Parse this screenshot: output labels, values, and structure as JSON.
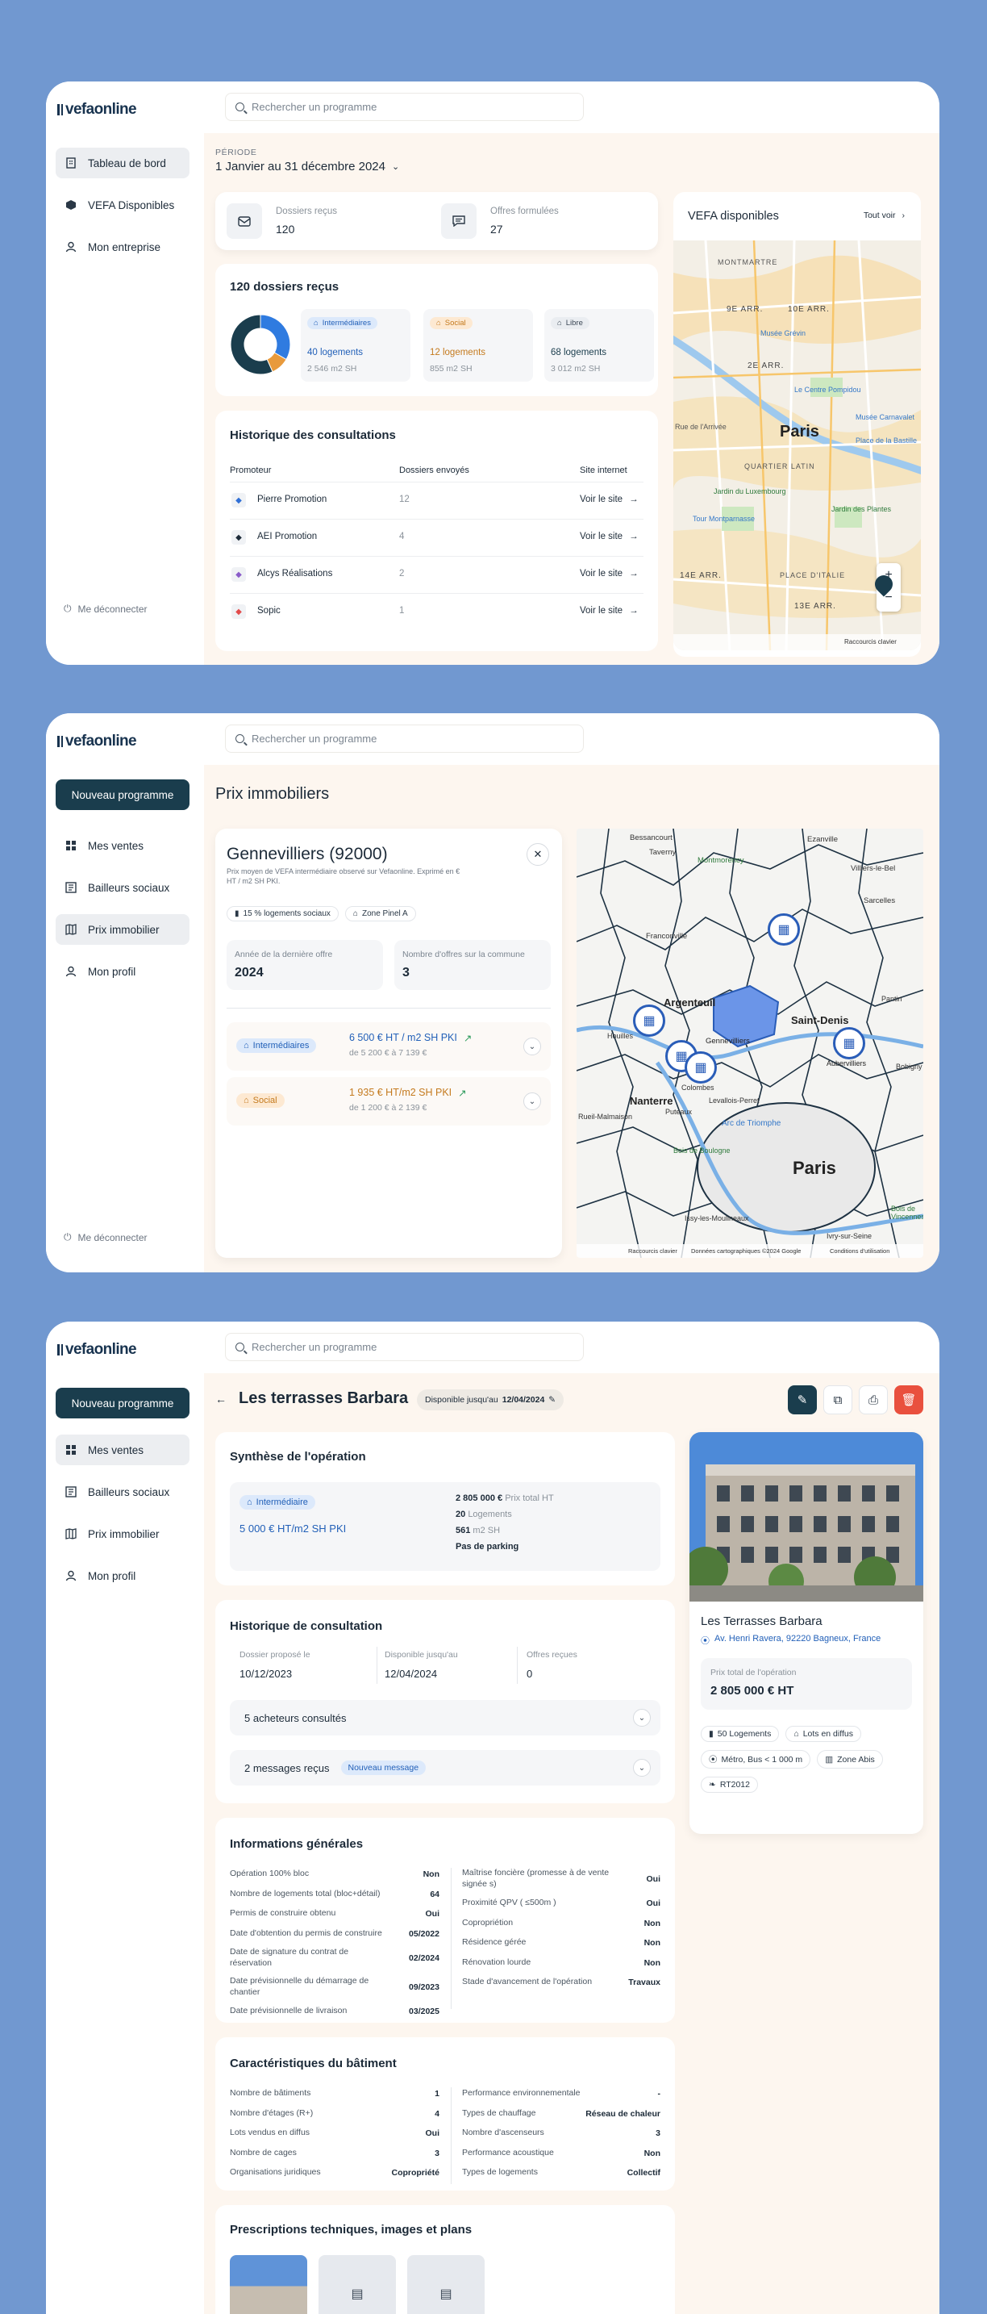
{
  "logo": "vefaonline",
  "search_placeholder": "Rechercher un programme",
  "logout": "Me déconnecter",
  "screen1": {
    "nav": [
      "Tableau de bord",
      "VEFA Disponibles",
      "Mon entreprise"
    ],
    "period_label": "PÉRIODE",
    "period_value": "1 Janvier au 31 décembre 2024",
    "stats": [
      {
        "label": "Dossiers reçus",
        "value": "120"
      },
      {
        "label": "Offres formulées",
        "value": "27"
      }
    ],
    "dossiers_title": "120 dossiers reçus",
    "donut": [
      {
        "name": "Intermédiaires",
        "logements": "40 logements",
        "surface": "2 546 m2 SH",
        "value": 40,
        "color": "#2f7be0"
      },
      {
        "name": "Social",
        "logements": "12 logements",
        "surface": "855 m2 SH",
        "value": 12,
        "color": "#e89a3c"
      },
      {
        "name": "Libre",
        "logements": "68 logements",
        "surface": "3 012 m2 SH",
        "value": 68,
        "color": "#1a3d4d"
      }
    ],
    "history_title": "Historique des consultations",
    "history_headers": [
      "Promoteur",
      "Dossiers envoyés",
      "Site internet"
    ],
    "history_rows": [
      {
        "name": "Pierre Promotion",
        "count": "12",
        "link": "Voir le site"
      },
      {
        "name": "AEI Promotion",
        "count": "4",
        "link": "Voir le site"
      },
      {
        "name": "Alcys Réalisations",
        "count": "2",
        "link": "Voir le site"
      },
      {
        "name": "Sopic",
        "count": "1",
        "link": "Voir le site"
      }
    ],
    "vefa_title": "VEFA disponibles",
    "vefa_link": "Tout voir",
    "map_labels": [
      "MONTMARTRE",
      "9E ARR.",
      "10E ARR.",
      "Musée Grévin",
      "2E ARR.",
      "Le Centre Pompidou",
      "Paris",
      "QUARTIER LATIN",
      "Jardin du Luxembourg",
      "Tour Montparnasse",
      "14E ARR.",
      "PLACE D'ITALIE",
      "13E ARR.",
      "Jardin des Plantes",
      "Musée Carnavalet",
      "Place de la Bastille",
      "Rue de l'Arrivée",
      "Raccourcis clavier"
    ]
  },
  "screen2": {
    "nav_button": "Nouveau programme",
    "nav": [
      "Mes ventes",
      "Bailleurs sociaux",
      "Prix immobilier",
      "Mon profil"
    ],
    "page_title": "Prix immobiliers",
    "city": "Gennevilliers (92000)",
    "city_desc": "Prix moyen de VEFA intermédiaire observé sur Vefaonline. Exprimé en € HT / m2 SH PKI.",
    "tags": [
      "15 % logements sociaux",
      "Zone Pinel A"
    ],
    "stats": [
      {
        "label": "Année de la dernière offre",
        "value": "2024"
      },
      {
        "label": "Nombre d'offres sur la commune",
        "value": "3"
      }
    ],
    "prices": [
      {
        "badge": "Intermédiaires",
        "price": "6 500 € HT / m2 SH PKI",
        "from": "de 5 200 € à 7 139 €"
      },
      {
        "badge": "Social",
        "price": "1 935 € HT/m2 SH PKI",
        "from": "de 1 200 € à 2 139 €"
      }
    ],
    "map_labels": [
      "Bessancourt",
      "Taverny",
      "Montmorency",
      "Ezanville",
      "Villiers-le-Bel",
      "Sarcelles",
      "Franconville",
      "Argenteuil",
      "Saint-Denis",
      "Gennevilliers",
      "Aubervilliers",
      "Nanterre",
      "Colombes",
      "Levallois-Perret",
      "Puteaux",
      "Rueil-Malmaison",
      "Arc de Triomphe",
      "Paris",
      "Bois de Boulogne",
      "Issy-les-Moulineaux",
      "Ivry-sur-Seine",
      "Pantin",
      "Bobigny",
      "Houilles",
      "Bois de Vincennes",
      "Raccourcis clavier",
      "Données cartographiques ©2024 Google",
      "Conditions d'utilisation"
    ]
  },
  "screen3": {
    "nav_button": "Nouveau programme",
    "nav": [
      "Mes ventes",
      "Bailleurs sociaux",
      "Prix immobilier",
      "Mon profil"
    ],
    "title": "Les terrasses Barbara",
    "availability_prefix": "Disponible jusqu'au",
    "availability_date": "12/04/2024",
    "synthese_title": "Synthèse de l'opération",
    "synthese_badge": "Intermédiaire",
    "synthese_price": "5 000 € HT/m2 SH PKI",
    "synthese_values": [
      {
        "value": "2 805 000 €",
        "label": "Prix total HT"
      },
      {
        "value": "20",
        "label": "Logements"
      },
      {
        "value": "561",
        "label": "m2 SH"
      }
    ],
    "parking": "Pas de parking",
    "history_title": "Historique de consultation",
    "history_fields": [
      {
        "label": "Dossier proposé le",
        "value": "10/12/2023"
      },
      {
        "label": "Disponible jusqu'au",
        "value": "12/04/2024"
      },
      {
        "label": "Offres reçues",
        "value": "0"
      }
    ],
    "buyers": "5 acheteurs consultés",
    "messages": "2 messages reçus",
    "messages_badge": "Nouveau message",
    "info_title": "Informations générales",
    "info_left": [
      {
        "k": "Opération 100% bloc",
        "v": "Non"
      },
      {
        "k": "Nombre de logements total (bloc+détail)",
        "v": "64"
      },
      {
        "k": "Permis de construire obtenu",
        "v": "Oui"
      },
      {
        "k": "Date d'obtention du permis de construire",
        "v": "05/2022"
      },
      {
        "k": "Date de signature du contrat de réservation",
        "v": "02/2024"
      },
      {
        "k": "Date prévisionnelle du démarrage de chantier",
        "v": "09/2023"
      },
      {
        "k": "Date prévisionnelle de livraison",
        "v": "03/2025"
      }
    ],
    "info_right": [
      {
        "k": "Maîtrise foncière (promesse à de vente signée s)",
        "v": "Oui"
      },
      {
        "k": "Proximité QPV ( ≤500m )",
        "v": "Oui"
      },
      {
        "k": "Copropriétion",
        "v": "Non"
      },
      {
        "k": "Résidence gérée",
        "v": "Non"
      },
      {
        "k": "Rénovation lourde",
        "v": "Non"
      },
      {
        "k": "Stade d'avancement de l'opération",
        "v": "Travaux"
      }
    ],
    "carac_title": "Caractéristiques du bâtiment",
    "carac_left": [
      {
        "k": "Nombre de bâtiments",
        "v": "1"
      },
      {
        "k": "Nombre d'étages (R+)",
        "v": "4"
      },
      {
        "k": "Lots vendus en diffus",
        "v": "Oui"
      },
      {
        "k": "Nombre de cages",
        "v": "3"
      },
      {
        "k": "Organisations juridiques",
        "v": "Copropriété"
      }
    ],
    "carac_right": [
      {
        "k": "Performance environnementale",
        "v": "-"
      },
      {
        "k": "Types de chauffage",
        "v": "Réseau de chaleur"
      },
      {
        "k": "Nombre d'ascenseurs",
        "v": "3"
      },
      {
        "k": "Performance acoustique",
        "v": "Non"
      },
      {
        "k": "Types de logements",
        "v": "Collectif"
      }
    ],
    "presc_title": "Prescriptions techniques, images et plans",
    "property_name": "Les Terrasses Barbara",
    "property_address": "Av. Henri Ravera, 92220 Bagneux, France",
    "total_label": "Prix total de l'opération",
    "total_value": "2 805 000 € HT",
    "chips": [
      "50 Logements",
      "Lots en diffus",
      "Métro, Bus < 1 000 m",
      "Zone Abis",
      "RT2012"
    ]
  }
}
